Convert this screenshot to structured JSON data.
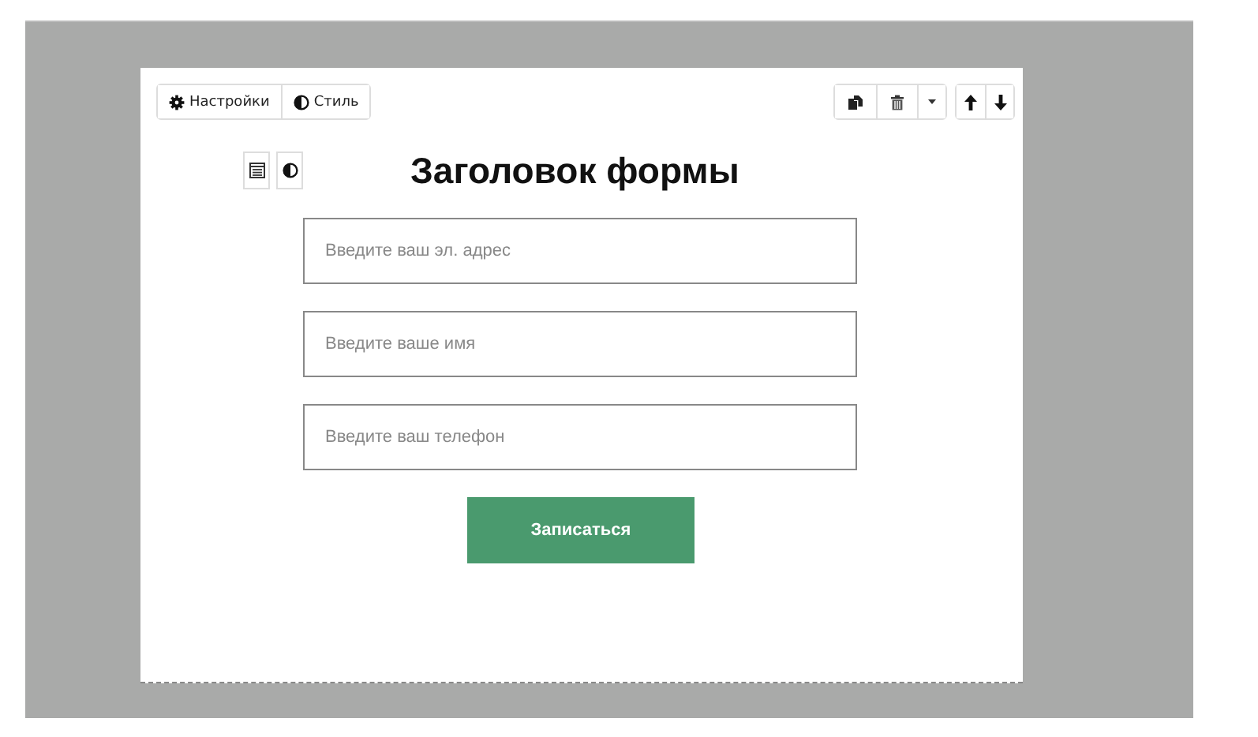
{
  "toolbar": {
    "left_buttons": [
      {
        "kind": "settings",
        "label": "Настройки"
      },
      {
        "kind": "style",
        "label": "Стиль"
      }
    ],
    "right_buttons": [
      {
        "kind": "copy"
      },
      {
        "kind": "delete"
      },
      {
        "kind": "dropdown"
      },
      {
        "kind": "up"
      },
      {
        "kind": "down"
      }
    ]
  },
  "form": {
    "title": "Заголовок формы",
    "fields": [
      {
        "placeholder": "Введите ваш эл. адрес"
      },
      {
        "placeholder": "Введите ваше имя"
      },
      {
        "placeholder": "Введите ваш телефон"
      }
    ],
    "submit": "Записаться"
  }
}
